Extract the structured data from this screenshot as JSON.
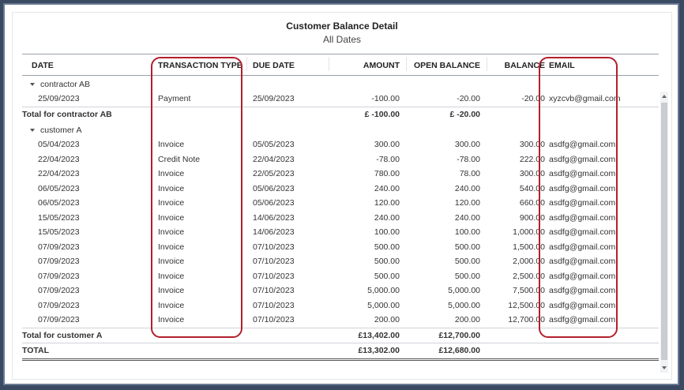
{
  "report": {
    "title": "Customer Balance Detail",
    "subtitle": "All Dates"
  },
  "columns": {
    "date": "DATE",
    "transaction_type": "TRANSACTION TYPE",
    "due_date": "DUE DATE",
    "amount": "AMOUNT",
    "open_balance": "OPEN BALANCE",
    "balance": "BALANCE",
    "email": "EMAIL"
  },
  "groups": [
    {
      "name": "contractor AB",
      "rows": [
        {
          "date": "25/09/2023",
          "type": "Payment",
          "due": "25/09/2023",
          "amount": "-100.00",
          "open": "-20.00",
          "balance": "-20.00",
          "email": "xyzcvb@gmail.com"
        }
      ],
      "total_label": "Total for contractor AB",
      "total_amount": "£ -100.00",
      "total_open": "£ -20.00"
    },
    {
      "name": "customer A",
      "rows": [
        {
          "date": "05/04/2023",
          "type": "Invoice",
          "due": "05/05/2023",
          "amount": "300.00",
          "open": "300.00",
          "balance": "300.00",
          "email": "asdfg@gmail.com"
        },
        {
          "date": "22/04/2023",
          "type": "Credit Note",
          "due": "22/04/2023",
          "amount": "-78.00",
          "open": "-78.00",
          "balance": "222.00",
          "email": "asdfg@gmail.com"
        },
        {
          "date": "22/04/2023",
          "type": "Invoice",
          "due": "22/05/2023",
          "amount": "780.00",
          "open": "78.00",
          "balance": "300.00",
          "email": "asdfg@gmail.com"
        },
        {
          "date": "06/05/2023",
          "type": "Invoice",
          "due": "05/06/2023",
          "amount": "240.00",
          "open": "240.00",
          "balance": "540.00",
          "email": "asdfg@gmail.com"
        },
        {
          "date": "06/05/2023",
          "type": "Invoice",
          "due": "05/06/2023",
          "amount": "120.00",
          "open": "120.00",
          "balance": "660.00",
          "email": "asdfg@gmail.com"
        },
        {
          "date": "15/05/2023",
          "type": "Invoice",
          "due": "14/06/2023",
          "amount": "240.00",
          "open": "240.00",
          "balance": "900.00",
          "email": "asdfg@gmail.com"
        },
        {
          "date": "15/05/2023",
          "type": "Invoice",
          "due": "14/06/2023",
          "amount": "100.00",
          "open": "100.00",
          "balance": "1,000.00",
          "email": "asdfg@gmail.com"
        },
        {
          "date": "07/09/2023",
          "type": "Invoice",
          "due": "07/10/2023",
          "amount": "500.00",
          "open": "500.00",
          "balance": "1,500.00",
          "email": "asdfg@gmail.com"
        },
        {
          "date": "07/09/2023",
          "type": "Invoice",
          "due": "07/10/2023",
          "amount": "500.00",
          "open": "500.00",
          "balance": "2,000.00",
          "email": "asdfg@gmail.com"
        },
        {
          "date": "07/09/2023",
          "type": "Invoice",
          "due": "07/10/2023",
          "amount": "500.00",
          "open": "500.00",
          "balance": "2,500.00",
          "email": "asdfg@gmail.com"
        },
        {
          "date": "07/09/2023",
          "type": "Invoice",
          "due": "07/10/2023",
          "amount": "5,000.00",
          "open": "5,000.00",
          "balance": "7,500.00",
          "email": "asdfg@gmail.com"
        },
        {
          "date": "07/09/2023",
          "type": "Invoice",
          "due": "07/10/2023",
          "amount": "5,000.00",
          "open": "5,000.00",
          "balance": "12,500.00",
          "email": "asdfg@gmail.com"
        },
        {
          "date": "07/09/2023",
          "type": "Invoice",
          "due": "07/10/2023",
          "amount": "200.00",
          "open": "200.00",
          "balance": "12,700.00",
          "email": "asdfg@gmail.com"
        }
      ],
      "total_label": "Total for customer A",
      "total_amount": "£13,402.00",
      "total_open": "£12,700.00"
    }
  ],
  "grand_total": {
    "label": "TOTAL",
    "amount": "£13,302.00",
    "open": "£12,680.00"
  },
  "colors": {
    "highlight": "#b21f2d",
    "outer_background": "#3b4a63"
  }
}
